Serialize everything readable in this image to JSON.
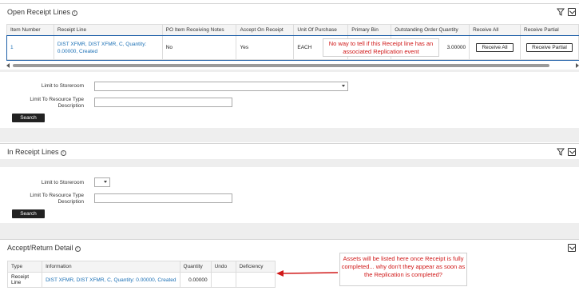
{
  "open_section": {
    "title": "Open Receipt Lines",
    "columns": [
      "Item Number",
      "Receipt Line",
      "PO Item Receiving Notes",
      "Accept On Receipt",
      "Unit Of Purchase",
      "Primary Bin",
      "Outstanding Order Quantity",
      "Receive All",
      "Receive Partial"
    ],
    "row": {
      "item_number": "1",
      "receipt_line": "DIST XFMR, DIST XFMR, C, Quantity: 0.00000, Created",
      "notes": "No",
      "accept": "Yes",
      "unit": "EACH",
      "bin": "",
      "quantity": "3.00000",
      "receive_all": "Receive All",
      "receive_partial": "Receive Partial"
    },
    "callout": "No way to tell if this Receipt line has an associated Replication event"
  },
  "open_filters": {
    "storeroom_label": "Limit to Storeroom",
    "resource_label": "Limit To Resource Type Description",
    "storeroom_value": "",
    "resource_value": "",
    "search": "Search"
  },
  "in_section": {
    "title": "In Receipt Lines"
  },
  "in_filters": {
    "storeroom_label": "Limit to Storeroom",
    "resource_label": "Limit To Resource Type Description",
    "storeroom_value": "",
    "resource_value": "",
    "search": "Search"
  },
  "accept_section": {
    "title": "Accept/Return Detail",
    "columns": [
      "Type",
      "Information",
      "Quantity",
      "Undo",
      "Deficiency"
    ],
    "row": {
      "type": "Receipt Line",
      "information": "DIST XFMR, DIST XFMR, C, Quantity: 0.00000, Created",
      "quantity": "0.00000",
      "undo": "",
      "deficiency": ""
    },
    "callout": "Assets will be listed here once Receipt is fully completed... why don't they appear as soon as the Replication is completed?"
  },
  "colors": {
    "link": "#1a6fb5",
    "callout_text": "#d01818",
    "arrow": "#d01818",
    "row_border": "#1e5fa8"
  }
}
